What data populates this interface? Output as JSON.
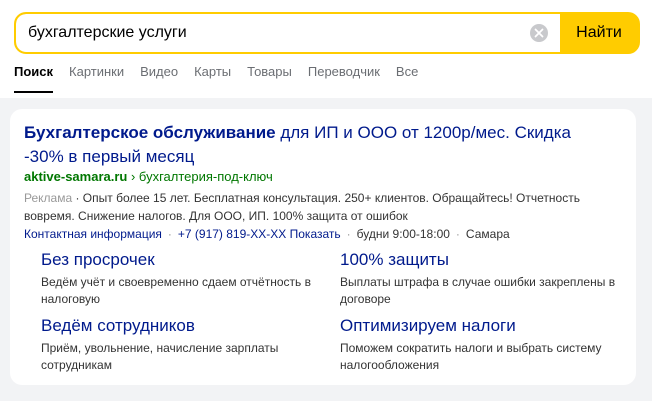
{
  "search": {
    "query": "бухгалтерские услуги",
    "button_label": "Найти"
  },
  "tabs": [
    {
      "label": "Поиск",
      "active": true
    },
    {
      "label": "Картинки",
      "active": false
    },
    {
      "label": "Видео",
      "active": false
    },
    {
      "label": "Карты",
      "active": false
    },
    {
      "label": "Товары",
      "active": false
    },
    {
      "label": "Переводчик",
      "active": false
    },
    {
      "label": "Все",
      "active": false
    }
  ],
  "ad": {
    "title_bold": "Бухгалтерское обслуживание",
    "title_rest": " для ИП и ООО от 1200р/мес. Скидка -30% в первый месяц",
    "url_domain": "aktive-samara.ru",
    "url_sep": " › ",
    "url_path": "бухгалтерия-под-ключ",
    "ad_label": "Реклама",
    "desc": " · Опыт более 15 лет. Бесплатная консультация. 250+ клиентов. Обращайтесь! Отчетность вовремя. Снижение налогов. Для ООО, ИП. 100% защита от ошибок",
    "contact_link": "Контактная информация",
    "phone": "+7 (917) 819-XX-XX",
    "phone_show": " Показать",
    "hours": "будни 9:00-18:00",
    "city": "Самара"
  },
  "sitelinks": [
    {
      "title": "Без просрочек",
      "desc": "Ведём учёт и своевременно сдаем отчётность в налоговую"
    },
    {
      "title": "100% защиты",
      "desc": "Выплаты штрафа в случае ошибки закреплены в договоре"
    },
    {
      "title": "Ведём сотрудников",
      "desc": "Приём, увольнение, начисление зарплаты сотрудникам"
    },
    {
      "title": "Оптимизируем налоги",
      "desc": "Поможем сократить налоги и выбрать систему налогообложения"
    }
  ],
  "colors": {
    "accent": "#ffcc00",
    "link": "#001a8c",
    "url_green": "#007700",
    "background": "#f2f3f5"
  }
}
